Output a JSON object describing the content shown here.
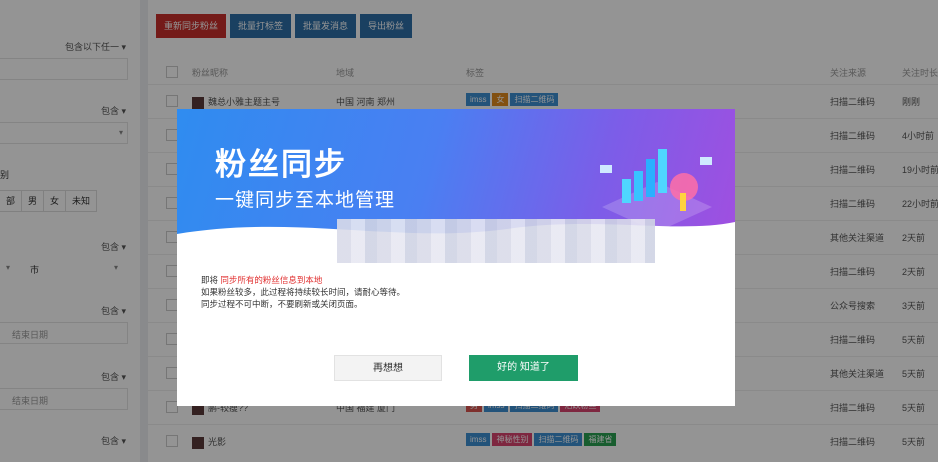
{
  "toolbar": {
    "resync": "重新同步粉丝",
    "batch_tag": "批量打标签",
    "batch_msg": "批量发消息",
    "export": "导出粉丝"
  },
  "filters": {
    "contains_any": "包含以下任一",
    "contains_1": "包含",
    "contains_2": "包含",
    "contains_3": "包含",
    "contains_4": "包含",
    "contains_5": "包含",
    "partial_label": "别",
    "gender": [
      "部",
      "男",
      "女",
      "未知"
    ],
    "city": "市",
    "end_date_1": "结束日期",
    "end_date_2": "结束日期"
  },
  "table": {
    "headers": {
      "nickname": "粉丝昵称",
      "region": "地域",
      "tags": "标签",
      "source": "关注来源",
      "time": "关注时长"
    },
    "rows": [
      {
        "name": "魏总小雅主题主号",
        "region": "中国 河南 郑州",
        "tags": [
          {
            "t": "imss",
            "c": "blue"
          },
          {
            "t": "女",
            "c": "orange"
          },
          {
            "t": "扫描二维码",
            "c": "blue"
          }
        ],
        "source": "扫描二维码",
        "time": "刚刚"
      },
      {
        "name": "",
        "region": "",
        "tags": [],
        "source": "扫描二维码",
        "time": "4小时前"
      },
      {
        "name": "",
        "region": "",
        "tags": [],
        "source": "扫描二维码",
        "time": "19小时前"
      },
      {
        "name": "",
        "region": "",
        "tags": [],
        "source": "扫描二维码",
        "time": "22小时前"
      },
      {
        "name": "",
        "region": "",
        "tags": [],
        "source": "其他关注渠道",
        "time": "2天前"
      },
      {
        "name": "",
        "region": "",
        "tags": [],
        "source": "扫描二维码",
        "time": "2天前"
      },
      {
        "name": "",
        "region": "",
        "tags": [],
        "source": "公众号搜索",
        "time": "3天前"
      },
      {
        "name": "",
        "region": "",
        "tags": [],
        "source": "扫描二维码",
        "time": "5天前"
      },
      {
        "name": "",
        "region": "",
        "tags": [],
        "source": "其他关注渠道",
        "time": "5天前"
      },
      {
        "name": "鹏-较瘦??",
        "region": "中国 福建 厦门",
        "tags": [
          {
            "t": "男",
            "c": "red"
          },
          {
            "t": "imss",
            "c": "blue"
          },
          {
            "t": "扫描二维码",
            "c": "blue"
          },
          {
            "t": "活跃粉丝",
            "c": "pink"
          }
        ],
        "source": "扫描二维码",
        "time": "5天前"
      },
      {
        "name": "光影",
        "region": "",
        "tags": [
          {
            "t": "imss",
            "c": "blue"
          },
          {
            "t": "神秘性别",
            "c": "pink"
          },
          {
            "t": "扫描二维码",
            "c": "blue"
          },
          {
            "t": "福建省",
            "c": "green"
          }
        ],
        "source": "扫描二维码",
        "time": "5天前"
      }
    ]
  },
  "modal": {
    "title": "粉丝同步",
    "subtitle": "一键同步至本地管理",
    "line1_prefix": "即将",
    "line1_highlight": "同步所有的粉丝信息到本地",
    "line2": "如果粉丝较多，此过程将持续较长时间，请耐心等待。",
    "line3": "同步过程不可中断，不要刷新或关闭页面。",
    "cancel_label": "再想想",
    "ok_label": "好的 知道了"
  },
  "colors": {
    "primary_green": "#1f9d6a",
    "toolbar_red": "#c9302c",
    "toolbar_blue": "#2d6fa8",
    "highlight_red": "#e12f2f"
  }
}
